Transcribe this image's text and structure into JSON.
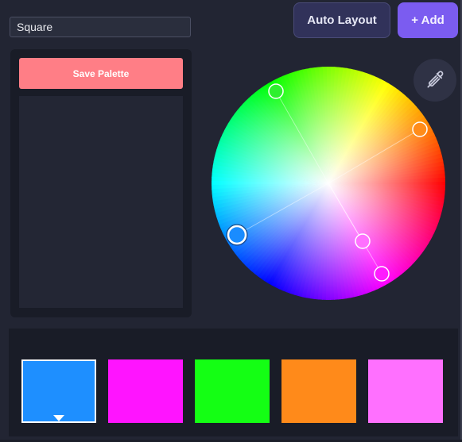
{
  "toolbar": {
    "harmony_mode": "Square",
    "auto_layout_label": "Auto Layout",
    "add_label": "+ Add"
  },
  "palette_panel": {
    "save_label": "Save Palette"
  },
  "picker": {
    "icon": "eyedropper-icon"
  },
  "wheel": {
    "handles": [
      {
        "name": "green",
        "color": "#2ef02e"
      },
      {
        "name": "orange",
        "color": "#ff8c1a"
      },
      {
        "name": "blue",
        "color": "#1a8cff",
        "active": true
      },
      {
        "name": "pink",
        "color": "#ff70ff"
      },
      {
        "name": "magenta",
        "color": "#ff1aff"
      }
    ]
  },
  "swatches": [
    {
      "color": "#1e8fff",
      "selected": true
    },
    {
      "color": "#ff14ff",
      "selected": false
    },
    {
      "color": "#14ff14",
      "selected": false
    },
    {
      "color": "#ff8a1a",
      "selected": false
    },
    {
      "color": "#ff70ff",
      "selected": false
    }
  ]
}
